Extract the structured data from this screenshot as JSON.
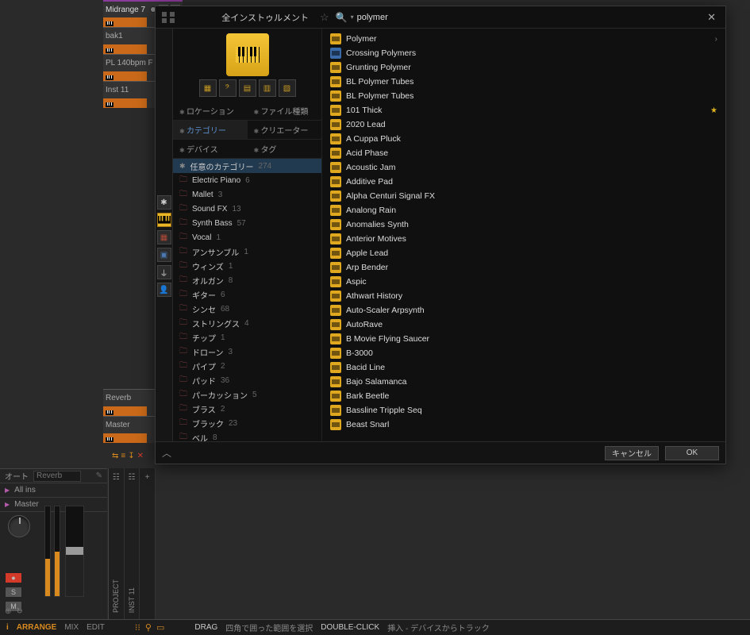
{
  "tracks": [
    {
      "name": "Midrange 7",
      "is_mid": true,
      "sm": true
    },
    {
      "name": "bak1"
    },
    {
      "name": "PL 140bpm F"
    },
    {
      "name": "Inst 11"
    }
  ],
  "bus_tracks": [
    {
      "name": "Reverb"
    },
    {
      "name": "Master"
    }
  ],
  "mixer": {
    "auto_label": "オート",
    "insert_placeholder": "Reverb",
    "row1_label": "All ins",
    "row2_label": "Master",
    "s_label": "S",
    "m_label": "M"
  },
  "channels": [
    {
      "label": "PROJECT"
    },
    {
      "label": "INST 11"
    }
  ],
  "status": {
    "i": "i",
    "arrange": "ARRANGE",
    "mix": "MIX",
    "edit": "EDIT",
    "drag_label": "DRAG",
    "drag_text": "四角で囲った範囲を選択",
    "dbl_label": "DOUBLE-CLICK",
    "dbl_text": "挿入 - デバイスからトラック"
  },
  "popup": {
    "title": "全インストゥルメント",
    "search_value": "polymer",
    "filters": [
      {
        "label": "ロケーション"
      },
      {
        "label": "ファイル種類"
      },
      {
        "label": "カテゴリー",
        "on": true
      },
      {
        "label": "クリエーター"
      },
      {
        "label": "デバイス"
      },
      {
        "label": "タグ"
      }
    ],
    "categories": [
      {
        "name": "任意のカテゴリー",
        "count": "274",
        "on": true,
        "icon": "star"
      },
      {
        "name": "Electric Piano",
        "count": "6"
      },
      {
        "name": "Mallet",
        "count": "3"
      },
      {
        "name": "Sound FX",
        "count": "13"
      },
      {
        "name": "Synth Bass",
        "count": "57"
      },
      {
        "name": "Vocal",
        "count": "1"
      },
      {
        "name": "アンサンブル",
        "count": "1"
      },
      {
        "name": "ウィンズ",
        "count": "1"
      },
      {
        "name": "オルガン",
        "count": "8"
      },
      {
        "name": "ギター",
        "count": "6"
      },
      {
        "name": "シンセ",
        "count": "68"
      },
      {
        "name": "ストリングス",
        "count": "4"
      },
      {
        "name": "チップ",
        "count": "1"
      },
      {
        "name": "ドローン",
        "count": "3"
      },
      {
        "name": "パイプ",
        "count": "2"
      },
      {
        "name": "パッド",
        "count": "36"
      },
      {
        "name": "パーカッション",
        "count": "5"
      },
      {
        "name": "ブラス",
        "count": "2"
      },
      {
        "name": "ブラック",
        "count": "23"
      },
      {
        "name": "ベル",
        "count": "8"
      }
    ],
    "results": [
      {
        "name": "Polymer",
        "chev": true
      },
      {
        "name": "Crossing Polymers",
        "alt": true
      },
      {
        "name": "Grunting Polymer"
      },
      {
        "name": "BL Polymer Tubes"
      },
      {
        "name": "BL Polymer Tubes"
      },
      {
        "name": "101 Thick",
        "star": true
      },
      {
        "name": "2020 Lead"
      },
      {
        "name": "A Cuppa Pluck"
      },
      {
        "name": "Acid Phase"
      },
      {
        "name": "Acoustic Jam"
      },
      {
        "name": "Additive Pad"
      },
      {
        "name": "Alpha Centuri Signal FX"
      },
      {
        "name": "Analong Rain"
      },
      {
        "name": "Anomalies Synth"
      },
      {
        "name": "Anterior Motives"
      },
      {
        "name": "Apple Lead"
      },
      {
        "name": "Arp Bender"
      },
      {
        "name": "Aspic"
      },
      {
        "name": "Athwart History"
      },
      {
        "name": "Auto-Scaler Arpsynth"
      },
      {
        "name": "AutoRave"
      },
      {
        "name": "B Movie Flying Saucer"
      },
      {
        "name": "B-3000"
      },
      {
        "name": "Bacid Line"
      },
      {
        "name": "Bajo Salamanca"
      },
      {
        "name": "Bark Beetle"
      },
      {
        "name": "Bassline Tripple Seq"
      },
      {
        "name": "Beast Snarl"
      }
    ],
    "btn_cancel": "キャンセル",
    "btn_ok": "OK"
  }
}
